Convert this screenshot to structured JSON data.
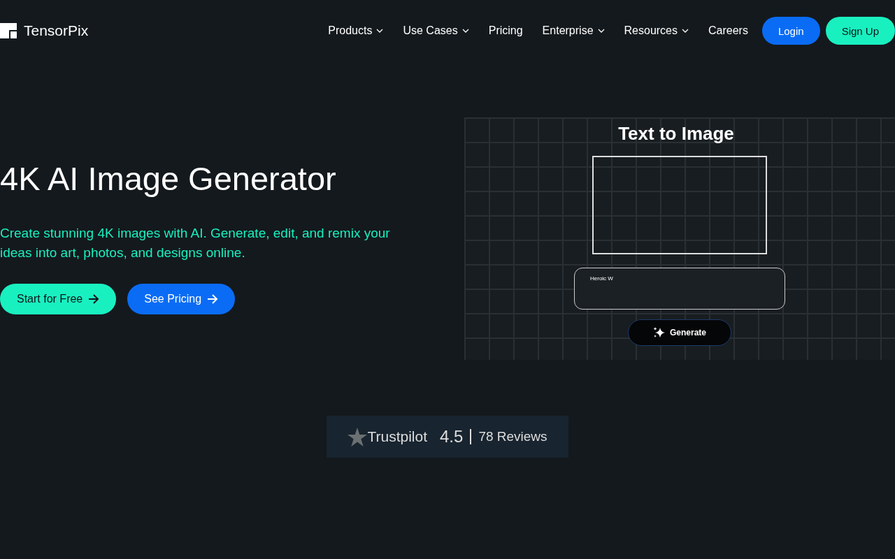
{
  "header": {
    "logo": "TensorPix",
    "nav": [
      {
        "label": "Products",
        "kind": "dropdown"
      },
      {
        "label": "Use Cases",
        "kind": "dropdown"
      },
      {
        "label": "Pricing",
        "kind": "link"
      },
      {
        "label": "Enterprise",
        "kind": "dropdown"
      },
      {
        "label": "Resources",
        "kind": "dropdown"
      },
      {
        "label": "Careers",
        "kind": "link"
      }
    ],
    "buttons": [
      {
        "label": "Login",
        "kind": "primary"
      },
      {
        "label": "Sign Up",
        "kind": "accent"
      }
    ]
  },
  "hero": {
    "title": "4K AI Image Generator",
    "subtitle": "Create stunning 4K images with AI. Generate, edit, and remix your ideas into art, photos, and designs online.",
    "buttons": [
      {
        "label": "Start for Free",
        "kind": "accent"
      },
      {
        "label": "See Pricing",
        "kind": "primary"
      }
    ]
  },
  "demo": {
    "title": "Text to Image",
    "prompt": "Heroic W",
    "button": "Generate"
  },
  "rating": {
    "brand": "Trustpilot",
    "score": "4.5",
    "reviews": "78 Reviews"
  }
}
